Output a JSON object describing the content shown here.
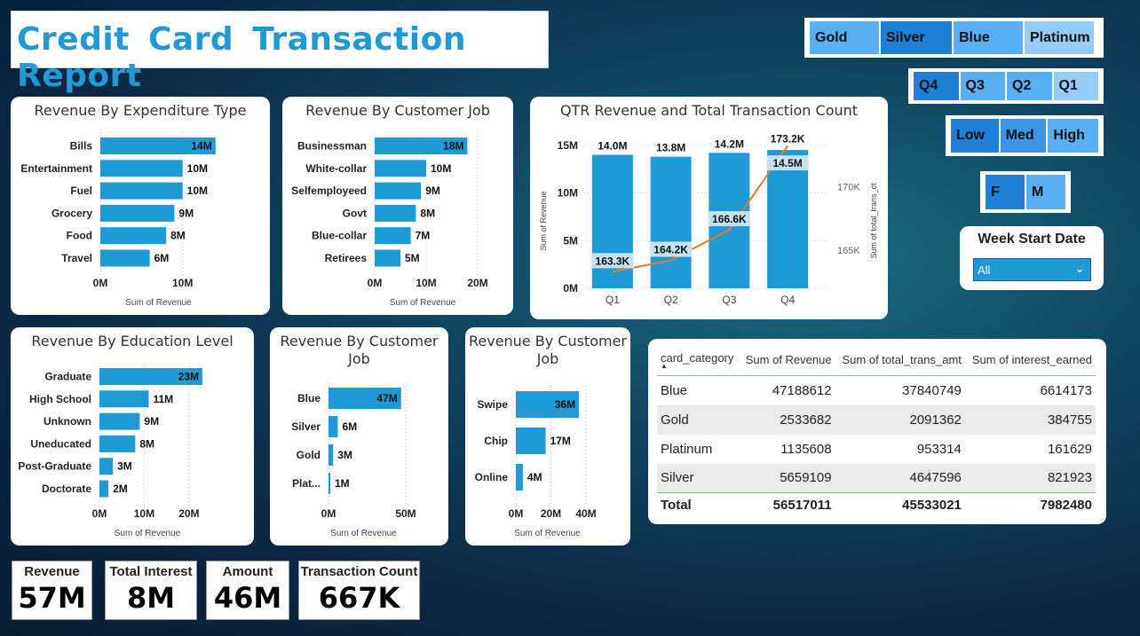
{
  "title": "Credit Card Transaction Report",
  "slicers": {
    "card_category": [
      "Gold",
      "Silver",
      "Blue",
      "Platinum"
    ],
    "quarter": [
      "Q4",
      "Q3",
      "Q2",
      "Q1"
    ],
    "level": [
      "Low",
      "Med",
      "High"
    ],
    "gender": [
      "F",
      "M"
    ],
    "week_start": {
      "label": "Week Start Date",
      "value": "All"
    }
  },
  "colors": {
    "bar": "#1f9ad6",
    "line": "#e8782c",
    "title": "#1f9ad6"
  },
  "kpis": [
    {
      "label": "Revenue",
      "value": "57M"
    },
    {
      "label": "Total Interest",
      "value": "8M"
    },
    {
      "label": "Amount",
      "value": "46M"
    },
    {
      "label": "Transaction Count",
      "value": "667K"
    }
  ],
  "chart_data": [
    {
      "type": "bar",
      "title": "Revenue By Expenditure Type",
      "categories": [
        "Bills",
        "Entertainment",
        "Fuel",
        "Grocery",
        "Food",
        "Travel"
      ],
      "values": [
        14,
        10,
        10,
        9,
        8,
        6
      ],
      "labels": [
        "14M",
        "10M",
        "10M",
        "9M",
        "8M",
        "6M"
      ],
      "xticks": [
        "0M",
        "10M"
      ],
      "xlabel": "Sum of Revenue",
      "xlim": [
        0,
        15
      ]
    },
    {
      "type": "bar",
      "title": "Revenue By Customer Job",
      "categories": [
        "Businessman",
        "White-collar",
        "Selfemployeed",
        "Govt",
        "Blue-collar",
        "Retirees"
      ],
      "values": [
        18,
        10,
        9,
        8,
        7,
        5
      ],
      "labels": [
        "18M",
        "10M",
        "9M",
        "8M",
        "7M",
        "5M"
      ],
      "xticks": [
        "0M",
        "10M",
        "20M"
      ],
      "xlabel": "Sum of Revenue",
      "xlim": [
        0,
        20
      ]
    },
    {
      "type": "bar",
      "title": "QTR Revenue and Total Transaction Count",
      "categories": [
        "Q1",
        "Q2",
        "Q3",
        "Q4"
      ],
      "series": [
        {
          "values": [
            14.0,
            13.8,
            14.2,
            14.5
          ],
          "labels": [
            "14.0M",
            "13.8M",
            "14.2M",
            "14.5M"
          ]
        },
        {
          "values": [
            163.3,
            164.2,
            166.6,
            173.2
          ],
          "labels": [
            "163.3K",
            "164.2K",
            "166.6K",
            "173.2K"
          ]
        }
      ],
      "ylabel": "Sum of Revenue",
      "y2label": "Sum of total_trans_ct",
      "yticks": [
        "0M",
        "5M",
        "10M",
        "15M"
      ],
      "y2ticks": [
        "165K",
        "170K"
      ],
      "ylim": [
        0,
        16
      ],
      "y2lim": [
        162,
        174
      ]
    },
    {
      "type": "bar",
      "title": "Revenue By Education Level",
      "categories": [
        "Graduate",
        "High School",
        "Unknown",
        "Uneducated",
        "Post-Graduate",
        "Doctorate"
      ],
      "values": [
        23,
        11,
        9,
        8,
        3,
        2
      ],
      "labels": [
        "23M",
        "11M",
        "9M",
        "8M",
        "3M",
        "2M"
      ],
      "xticks": [
        "0M",
        "10M",
        "20M"
      ],
      "xlabel": "Sum of Revenue",
      "xlim": [
        0,
        23
      ]
    },
    {
      "type": "bar",
      "title": "Revenue By Customer Job",
      "categories": [
        "Blue",
        "Silver",
        "Gold",
        "Plat..."
      ],
      "values": [
        47,
        6,
        3,
        1
      ],
      "labels": [
        "47M",
        "6M",
        "3M",
        "1M"
      ],
      "xticks": [
        "0M",
        "50M"
      ],
      "xlabel": "Sum of Revenue",
      "xlim": [
        0,
        50
      ]
    },
    {
      "type": "bar",
      "title": "Revenue By Customer Job",
      "categories": [
        "Swipe",
        "Chip",
        "Online"
      ],
      "values": [
        36,
        17,
        4
      ],
      "labels": [
        "36M",
        "17M",
        "4M"
      ],
      "xticks": [
        "0M",
        "20M",
        "40M"
      ],
      "xlabel": "Sum of Revenue",
      "xlim": [
        0,
        40
      ]
    },
    {
      "type": "table",
      "columns": [
        "card_category",
        "Sum of Revenue",
        "Sum of total_trans_amt",
        "Sum of interest_earned"
      ],
      "rows": [
        [
          "Blue",
          "47188612",
          "37840749",
          "6614173"
        ],
        [
          "Gold",
          "2533682",
          "2091362",
          "384755"
        ],
        [
          "Platinum",
          "1135608",
          "953314",
          "161629"
        ],
        [
          "Silver",
          "5659109",
          "4647596",
          "821923"
        ]
      ],
      "total": [
        "Total",
        "56517011",
        "45533021",
        "7982480"
      ]
    }
  ]
}
